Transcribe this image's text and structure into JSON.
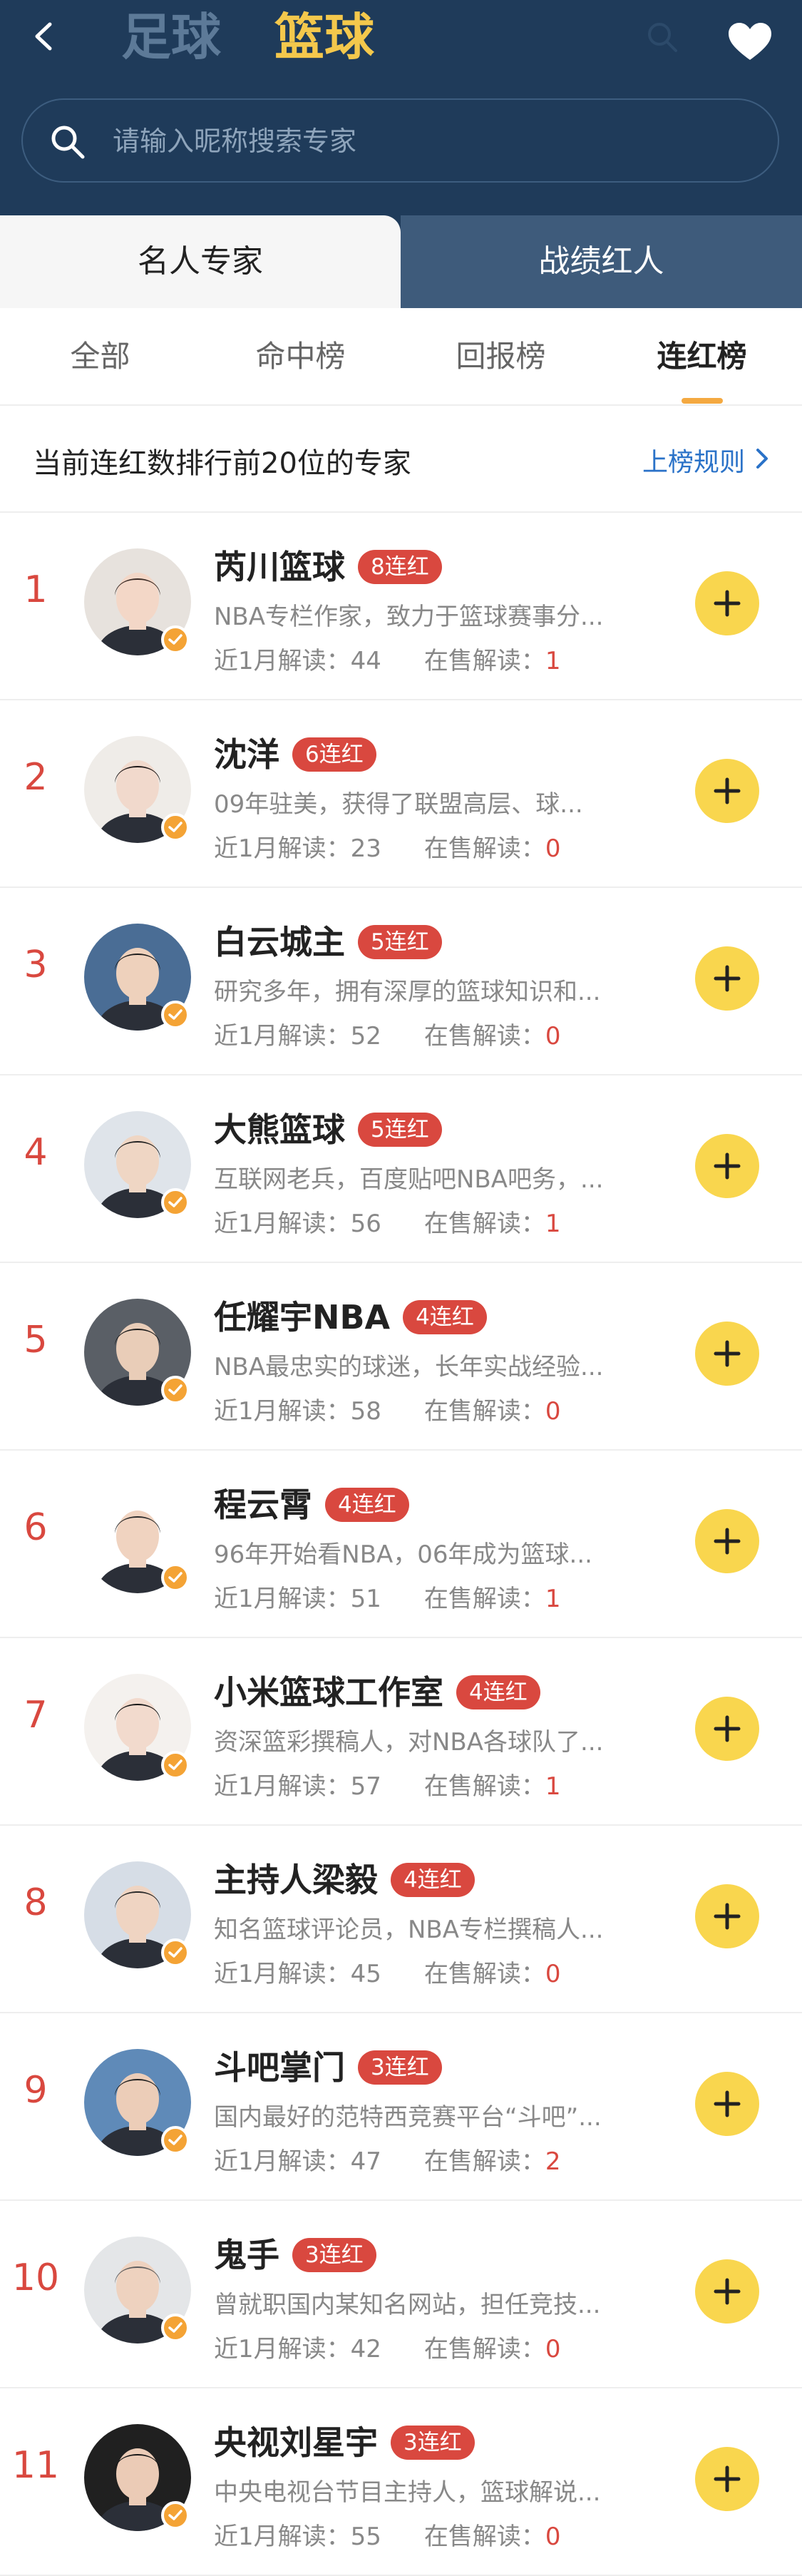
{
  "header": {
    "tabs": [
      "足球",
      "篮球"
    ],
    "active_tab": "篮球",
    "search_placeholder": "请输入昵称搜索专家"
  },
  "segments": [
    "名人专家",
    "战绩红人"
  ],
  "subtabs": [
    "全部",
    "命中榜",
    "回报榜",
    "连红榜"
  ],
  "info": {
    "text": "当前连红数排行前20位的专家",
    "rules_label": "上榜规则"
  },
  "stats_labels": {
    "recent": "近1月解读：",
    "selling": "在售解读："
  },
  "experts": [
    {
      "rank": "1",
      "name": "芮川篮球",
      "badge": "8连红",
      "desc": "NBA专栏作家，致力于篮球赛事分...",
      "recent": "44",
      "selling": "1"
    },
    {
      "rank": "2",
      "name": "沈洋",
      "badge": "6连红",
      "desc": "09年驻美，获得了联盟高层、球...",
      "recent": "23",
      "selling": "0"
    },
    {
      "rank": "3",
      "name": "白云城主",
      "badge": "5连红",
      "desc": "研究多年，拥有深厚的篮球知识和...",
      "recent": "52",
      "selling": "0"
    },
    {
      "rank": "4",
      "name": "大熊篮球",
      "badge": "5连红",
      "desc": "互联网老兵，百度贴吧NBA吧务，...",
      "recent": "56",
      "selling": "1"
    },
    {
      "rank": "5",
      "name": "任耀宇NBA",
      "badge": "4连红",
      "desc": "NBA最忠实的球迷，长年实战经验...",
      "recent": "58",
      "selling": "0"
    },
    {
      "rank": "6",
      "name": "程云霄",
      "badge": "4连红",
      "desc": "96年开始看NBA，06年成为篮球...",
      "recent": "51",
      "selling": "1"
    },
    {
      "rank": "7",
      "name": "小米篮球工作室",
      "badge": "4连红",
      "desc": "资深篮彩撰稿人，对NBA各球队了...",
      "recent": "57",
      "selling": "1"
    },
    {
      "rank": "8",
      "name": "主持人梁毅",
      "badge": "4连红",
      "desc": "知名篮球评论员，NBA专栏撰稿人...",
      "recent": "45",
      "selling": "0"
    },
    {
      "rank": "9",
      "name": "斗吧掌门",
      "badge": "3连红",
      "desc": "国内最好的范特西竞赛平台“斗吧”...",
      "recent": "47",
      "selling": "2"
    },
    {
      "rank": "10",
      "name": "鬼手",
      "badge": "3连红",
      "desc": "曾就职国内某知名网站，担任竞技...",
      "recent": "42",
      "selling": "0"
    },
    {
      "rank": "11",
      "name": "央视刘星宇",
      "badge": "3连红",
      "desc": "中央电视台节目主持人，篮球解说...",
      "recent": "55",
      "selling": "0"
    }
  ],
  "colors": {
    "header_bg": "#1f3b5a",
    "accent_yellow": "#f4c84c",
    "badge_red": "#d9483f",
    "follow_yellow": "#f9d64e",
    "link_blue": "#2a72c8"
  }
}
